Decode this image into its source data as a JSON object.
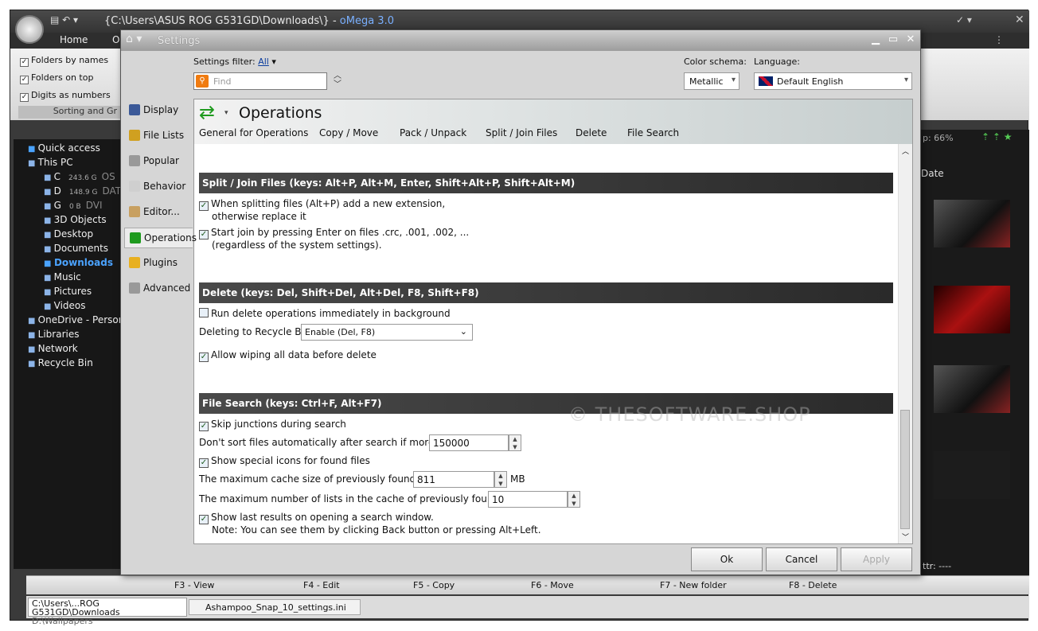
{
  "app": {
    "title_path": "{C:\\Users\\ASUS ROG G531GD\\Downloads\\}",
    "title_app": "oMega 3.0",
    "tab_home": "Home",
    "tab_o": "O"
  },
  "ribbon": {
    "folders_by_names": "Folders by names",
    "folders_on_top": "Folders on top",
    "digits_as_numbers": "Digits as numbers",
    "sorting": "Sorting and Gr"
  },
  "tree": [
    {
      "label": "Quick access"
    },
    {
      "label": "This PC"
    },
    {
      "label": "C",
      "size": "243.6 G",
      "suffix": "OS"
    },
    {
      "label": "D",
      "size": "148.9 G",
      "suffix": "DAT"
    },
    {
      "label": "G",
      "size": "0 B",
      "suffix": "DVI"
    },
    {
      "label": "3D Objects"
    },
    {
      "label": "Desktop"
    },
    {
      "label": "Documents"
    },
    {
      "label": "Downloads"
    },
    {
      "label": "Music"
    },
    {
      "label": "Pictures"
    },
    {
      "label": "Videos"
    },
    {
      "label": "OneDrive - Person"
    },
    {
      "label": "Libraries"
    },
    {
      "label": "Network"
    },
    {
      "label": "Recycle Bin"
    }
  ],
  "right": {
    "zoom": "p: 66%",
    "date_col": "Date",
    "attr": "ttr:",
    "attr_val": "----"
  },
  "cmd": {
    "f3": "F3 - View",
    "f4": "F4 - Edit",
    "f5": "F5 - Copy",
    "f6": "F6 - Move",
    "f7": "F7 - New folder",
    "f8": "F8 - Delete",
    "oper": "Oper"
  },
  "status": {
    "path": "C:\\Users\\...ROG G531GD\\Downloads",
    "path2": "D:\\Wallpapers",
    "tab2": "Ashampoo_Snap_10_settings.ini"
  },
  "dialog": {
    "title": "Settings",
    "filter_label": "Settings filter:",
    "filter_value": "All",
    "find_placeholder": "Find",
    "color_label": "Color schema:",
    "color_value": "Metallic",
    "lang_label": "Language:",
    "lang_value": "Default English",
    "nav": [
      "Display",
      "File Lists",
      "Popular",
      "Behavior",
      "Editor...",
      "Operations",
      "Plugins",
      "Advanced"
    ],
    "heading": "Operations",
    "tabs": [
      "General for Operations",
      "Copy / Move",
      "Pack / Unpack",
      "Split / Join Files",
      "Delete",
      "File Search"
    ],
    "split": {
      "title": "Split / Join Files    (keys: Alt+P, Alt+M, Enter, Shift+Alt+P, Shift+Alt+M)",
      "opt1a": "When splitting files (Alt+P) add a new extension,",
      "opt1b": "otherwise replace it",
      "opt2a": "Start join by pressing Enter on files .crc, .001, .002, ...",
      "opt2b": "(regardless of the system settings)."
    },
    "del": {
      "title": "Delete    (keys: Del, Shift+Del, Alt+Del, F8, Shift+F8)",
      "opt1": "Run delete operations immediately in background",
      "recycle_label": "Deleting to Recycle Bin:",
      "recycle_value": "Enable (Del, F8)",
      "opt2": "Allow wiping all data before delete"
    },
    "search": {
      "title": "File Search    (keys: Ctrl+F, Alt+F7)",
      "opt1": "Skip junctions during search",
      "sort_label": "Don't sort files automatically after search if more than:",
      "sort_value": "150000",
      "opt2": "Show special icons for found files",
      "cache_label": "The maximum cache size of previously found files:",
      "cache_value": "811",
      "cache_unit": "MB",
      "lists_label": "The maximum number of lists in the cache of previously found files:",
      "lists_value": "10",
      "opt3a": "Show last results on opening a search window.",
      "opt3b": "Note: You can see them by clicking Back button or pressing Alt+Left."
    },
    "ok": "Ok",
    "cancel": "Cancel",
    "apply": "Apply",
    "watermark": "© THESOFTWARE.SHOP"
  }
}
